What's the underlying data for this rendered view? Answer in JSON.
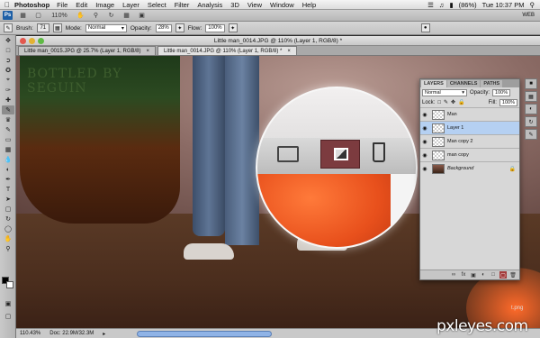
{
  "menubar": {
    "app": "Photoshop",
    "items": [
      "File",
      "Edit",
      "Image",
      "Layer",
      "Select",
      "Filter",
      "Analysis",
      "3D",
      "View",
      "Window",
      "Help"
    ],
    "battery": "(86%)",
    "clock": "Tue 10:37 PM"
  },
  "appbar": {
    "logo": "Ps",
    "zoom": "110%",
    "workspace": "WEB"
  },
  "options": {
    "brush_label": "Brush:",
    "brush_size": "71",
    "mode_label": "Mode:",
    "mode_value": "Normal",
    "opacity_label": "Opacity:",
    "opacity_value": "28%",
    "flow_label": "Flow:",
    "flow_value": "100%"
  },
  "window": {
    "title": "Little man_0014.JPG @ 110% (Layer 1, RGB/8) *",
    "tabs": [
      {
        "label": "Little man_0015.JPG @ 25.7% (Layer 1, RGB/8)"
      },
      {
        "label": "Little man_0014.JPG @ 110% (Layer 1, RGB/8) *"
      }
    ]
  },
  "canvas": {
    "bottle_text": "BOTTLED BY SEGUIN"
  },
  "status": {
    "zoom": "110.43%",
    "doc": "Doc: 22.9M/32.3M"
  },
  "layers_panel": {
    "tabs": [
      "LAYERS",
      "CHANNELS",
      "PATHS"
    ],
    "blend_mode": "Normal",
    "opacity_label": "Opacity:",
    "opacity_value": "100%",
    "lock_label": "Lock:",
    "fill_label": "Fill:",
    "fill_value": "100%",
    "layers": [
      {
        "name": "Man"
      },
      {
        "name": "Layer 1"
      },
      {
        "name": "Man copy 2"
      },
      {
        "name": "man copy"
      },
      {
        "name": "Background"
      }
    ]
  },
  "watermark": {
    "text": "pxleyes.com",
    "sub": "t.png"
  },
  "colors": {
    "accent": "#1d5fa6",
    "selected_layer": "#b5d0f2",
    "mask_button": "#7c3b3f"
  }
}
